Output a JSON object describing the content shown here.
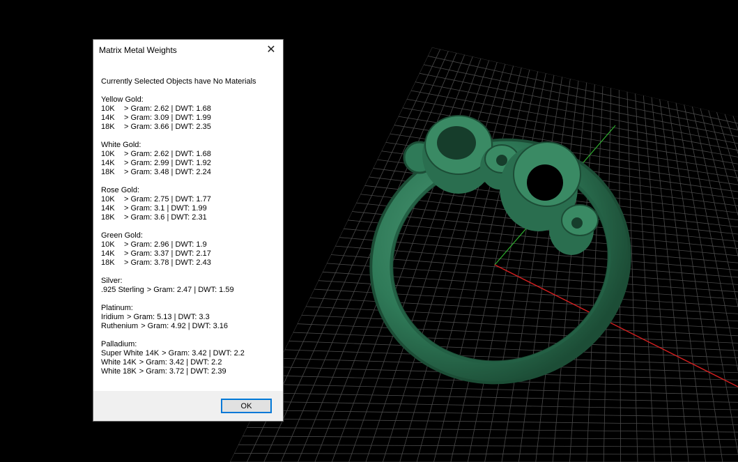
{
  "dialog": {
    "title": "Matrix Metal Weights",
    "close_glyph": "✕",
    "heading": "Currently Selected Objects have No Materials",
    "groups": [
      {
        "title": "Yellow Gold:",
        "rows": [
          {
            "k": "10K",
            "v": "> Gram: 2.62 | DWT: 1.68"
          },
          {
            "k": "14K",
            "v": "> Gram: 3.09 | DWT: 1.99"
          },
          {
            "k": "18K",
            "v": "> Gram: 3.66 | DWT: 2.35"
          }
        ]
      },
      {
        "title": "White Gold:",
        "rows": [
          {
            "k": "10K",
            "v": "> Gram: 2.62 | DWT: 1.68"
          },
          {
            "k": "14K",
            "v": "> Gram: 2.99 | DWT: 1.92"
          },
          {
            "k": "18K",
            "v": "> Gram: 3.48 | DWT: 2.24"
          }
        ]
      },
      {
        "title": "Rose Gold:",
        "rows": [
          {
            "k": "10K",
            "v": "> Gram: 2.75 | DWT: 1.77"
          },
          {
            "k": "14K",
            "v": "> Gram: 3.1 | DWT: 1.99"
          },
          {
            "k": "18K",
            "v": "> Gram: 3.6 | DWT: 2.31"
          }
        ]
      },
      {
        "title": "Green Gold:",
        "rows": [
          {
            "k": "10K",
            "v": "> Gram: 2.96 | DWT: 1.9"
          },
          {
            "k": "14K",
            "v": "> Gram: 3.37 | DWT: 2.17"
          },
          {
            "k": "18K",
            "v": "> Gram: 3.78 | DWT: 2.43"
          }
        ]
      },
      {
        "title": "Silver:",
        "rows": [
          {
            "k": ".925 Sterling",
            "v": "> Gram: 2.47 | DWT: 1.59",
            "wide": true
          }
        ]
      },
      {
        "title": "Platinum:",
        "rows": [
          {
            "k": "Iridium",
            "v": "> Gram: 5.13 | DWT: 3.3",
            "wide": true
          },
          {
            "k": "Ruthenium",
            "v": "> Gram: 4.92 | DWT: 3.16",
            "wide": true
          }
        ]
      },
      {
        "title": "Palladium:",
        "rows": [
          {
            "k": "Super White 14K",
            "v": "> Gram: 3.42 | DWT: 2.2",
            "wide": true
          },
          {
            "k": "White 14K",
            "v": "> Gram: 3.42 | DWT: 2.2",
            "wide": true
          },
          {
            "k": "White 18K",
            "v": "> Gram: 3.72 | DWT: 2.39",
            "wide": true
          }
        ]
      }
    ],
    "ok_label": "OK"
  },
  "viewport": {
    "background": "#000000",
    "grid_color": "#4a4a4a",
    "x_axis_color": "#d42020",
    "y_axis_color": "#2fae2f",
    "model_color": "#2f7a58",
    "model": "ring"
  }
}
